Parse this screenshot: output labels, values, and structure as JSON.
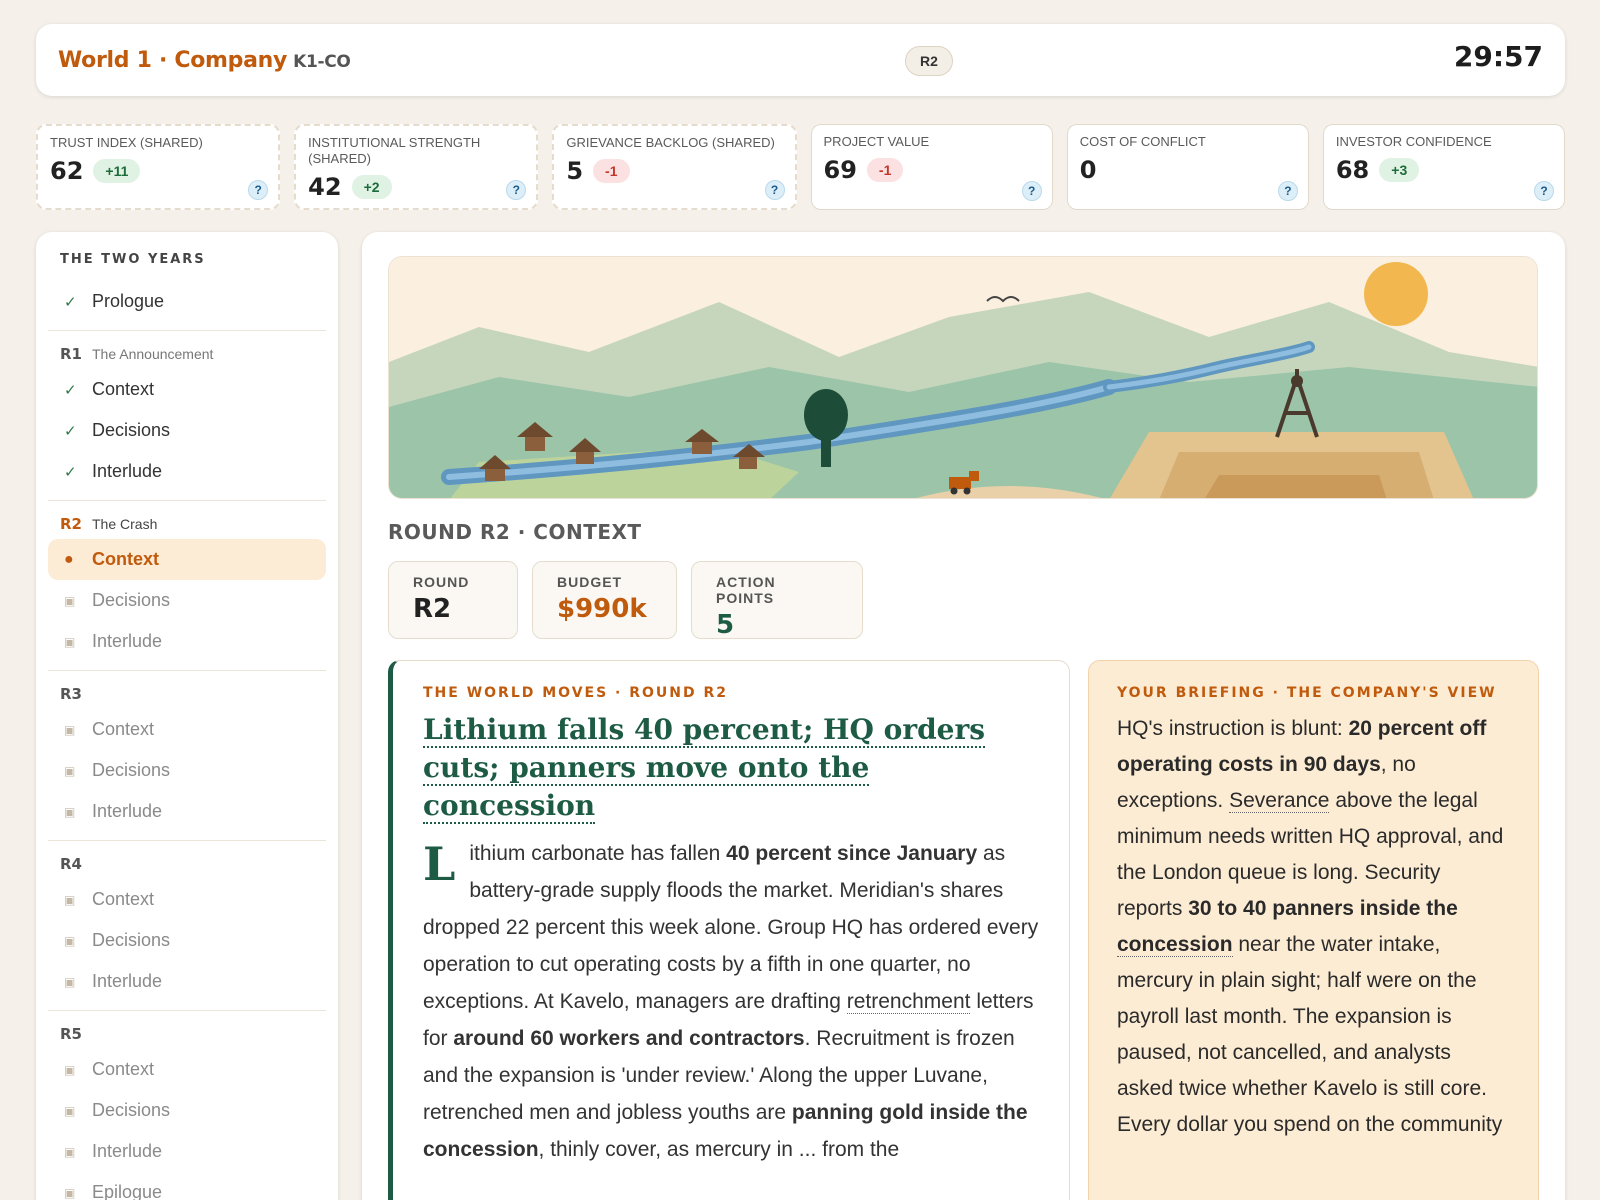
{
  "header": {
    "world": "World 1",
    "sep": " · ",
    "company": "Company",
    "code": "K1-CO",
    "round_pill": "R2",
    "timer": "29:57"
  },
  "metrics": [
    {
      "label": "TRUST INDEX (SHARED)",
      "value": "62",
      "delta": "+11",
      "dir": "up",
      "shared": true
    },
    {
      "label": "INSTITUTIONAL STRENGTH (SHARED)",
      "value": "42",
      "delta": "+2",
      "dir": "up",
      "shared": true
    },
    {
      "label": "GRIEVANCE BACKLOG (SHARED)",
      "value": "5",
      "delta": "-1",
      "dir": "dn",
      "shared": true
    },
    {
      "label": "PROJECT VALUE",
      "value": "69",
      "delta": "-1",
      "dir": "dn",
      "shared": false
    },
    {
      "label": "COST OF CONFLICT",
      "value": "0",
      "delta": "",
      "dir": "",
      "shared": false
    },
    {
      "label": "INVESTOR CONFIDENCE",
      "value": "68",
      "delta": "+3",
      "dir": "up",
      "shared": false
    }
  ],
  "help_label": "?",
  "sidebar": {
    "heading": "THE TWO YEARS",
    "prologue": "Prologue",
    "rounds": [
      {
        "code": "R1",
        "title": "The Announcement",
        "items": [
          {
            "label": "Context",
            "state": "done"
          },
          {
            "label": "Decisions",
            "state": "done"
          },
          {
            "label": "Interlude",
            "state": "done"
          }
        ]
      },
      {
        "code": "R2",
        "title": "The Crash",
        "current": true,
        "items": [
          {
            "label": "Context",
            "state": "active"
          },
          {
            "label": "Decisions",
            "state": "locked"
          },
          {
            "label": "Interlude",
            "state": "locked"
          }
        ]
      },
      {
        "code": "R3",
        "title": "",
        "items": [
          {
            "label": "Context",
            "state": "locked"
          },
          {
            "label": "Decisions",
            "state": "locked"
          },
          {
            "label": "Interlude",
            "state": "locked"
          }
        ]
      },
      {
        "code": "R4",
        "title": "",
        "items": [
          {
            "label": "Context",
            "state": "locked"
          },
          {
            "label": "Decisions",
            "state": "locked"
          },
          {
            "label": "Interlude",
            "state": "locked"
          }
        ]
      },
      {
        "code": "R5",
        "title": "",
        "items": [
          {
            "label": "Context",
            "state": "locked"
          },
          {
            "label": "Decisions",
            "state": "locked"
          },
          {
            "label": "Interlude",
            "state": "locked"
          },
          {
            "label": "Epilogue",
            "state": "locked"
          }
        ]
      }
    ]
  },
  "main": {
    "section_title": "ROUND R2 · CONTEXT",
    "stats": [
      {
        "label": "ROUND",
        "value": "R2",
        "tone": ""
      },
      {
        "label": "BUDGET",
        "value": "$990k",
        "tone": "orange"
      },
      {
        "label": "ACTION POINTS",
        "value": "5",
        "tone": "green"
      }
    ],
    "news": {
      "kicker": "THE WORLD MOVES · ROUND R2",
      "headline": "Lithium falls 40 percent; HQ orders cuts; panners move onto the concession",
      "dropcap": "L",
      "body": [
        {
          "t": "ithium carbonate has fallen "
        },
        {
          "t": "40 percent since January",
          "b": true
        },
        {
          "t": " as battery-grade supply floods the market. Meridian's shares dropped 22 percent this week alone. Group HQ has ordered every operation to cut operating costs by a fifth in one quarter, no exceptions. At Kavelo, managers are drafting "
        },
        {
          "t": "retrenchment",
          "u": true
        },
        {
          "t": " letters for "
        },
        {
          "t": "around 60 workers and contractors",
          "b": true
        },
        {
          "t": ". Recruitment is frozen and the expansion is 'under review.' Along the upper Luvane, retrenched men and jobless youths are "
        },
        {
          "t": "panning gold inside the concession",
          "b": true
        },
        {
          "t": ", thinly cover, as mercury in ... from the"
        }
      ]
    },
    "briefing": {
      "kicker": "YOUR BRIEFING · THE COMPANY'S VIEW",
      "body": [
        {
          "t": "HQ's instruction is blunt: "
        },
        {
          "t": "20 percent off operating costs in 90 days",
          "b": true
        },
        {
          "t": ", no exceptions. "
        },
        {
          "t": "Severance",
          "u": true
        },
        {
          "t": " above the legal minimum needs written HQ approval, and the London queue is long. Security reports "
        },
        {
          "t": "30 to 40 panners inside the ",
          "b": true
        },
        {
          "t": "concession",
          "b": true,
          "u": true
        },
        {
          "t": " near the water intake, mercury in plain sight; half were on the payroll last month. The expansion is paused, not cancelled, and analysts asked twice whether Kavelo is still core. Every dollar you spend on the community"
        }
      ]
    }
  },
  "colors": {
    "accent": "#c05a0c",
    "green": "#1d5b45",
    "done": "#2e7a4a",
    "delta_up": "#1d6b3a",
    "delta_down": "#c0392b"
  }
}
